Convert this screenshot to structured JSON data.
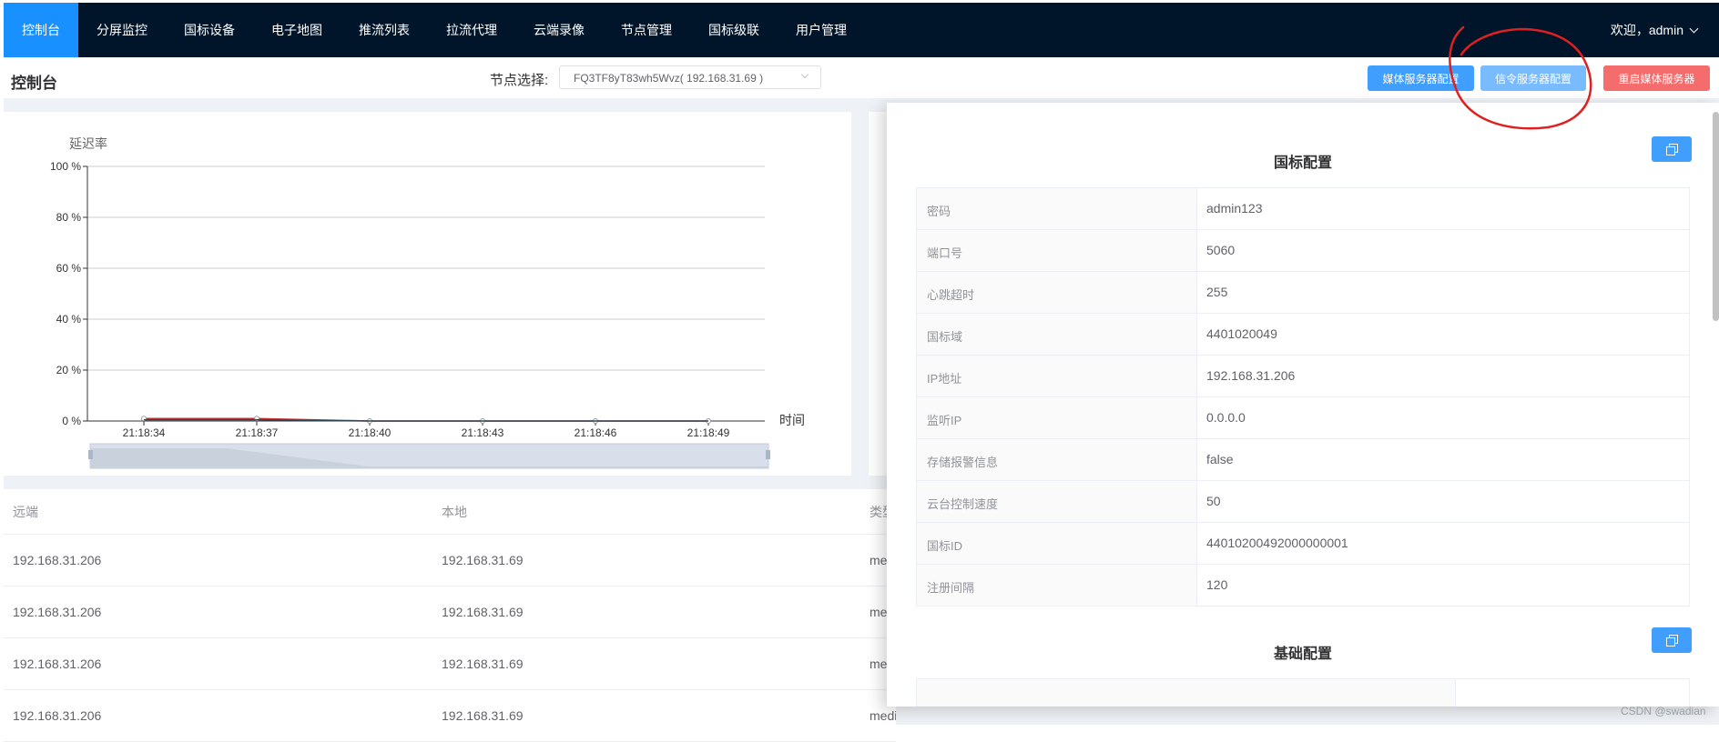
{
  "nav": {
    "items": [
      {
        "label": "控制台",
        "active": true
      },
      {
        "label": "分屏监控"
      },
      {
        "label": "国标设备"
      },
      {
        "label": "电子地图"
      },
      {
        "label": "推流列表"
      },
      {
        "label": "拉流代理"
      },
      {
        "label": "云端录像"
      },
      {
        "label": "节点管理"
      },
      {
        "label": "国标级联"
      },
      {
        "label": "用户管理"
      }
    ],
    "welcome": "欢迎，admin",
    "brand_color": "#001529",
    "active_color": "#1890ff"
  },
  "header": {
    "title": "控制台",
    "node_label": "节点选择:",
    "node_value": "FQ3TF8yT83wh5Wvz( 192.168.31.69 )",
    "btn_media": "媒体服务器配置",
    "btn_signal": "信令服务器配置",
    "btn_restart": "重启媒体服务器"
  },
  "chart_data": {
    "type": "line",
    "title": "",
    "ylabel": "延迟率",
    "xlabel": "时间",
    "ylim": [
      0,
      100
    ],
    "yticks": [
      "100 %",
      "80 %",
      "60 %",
      "40 %",
      "20 %",
      "0 %"
    ],
    "categories": [
      "21:18:34",
      "21:18:37",
      "21:18:40",
      "21:18:43",
      "21:18:46",
      "21:18:49"
    ],
    "series": [
      {
        "name": "",
        "color": "#c23531",
        "values": [
          1,
          1,
          0,
          0,
          0,
          0
        ]
      },
      {
        "name": "",
        "color": "#2f4554",
        "values": [
          0.5,
          0.5,
          0,
          0,
          0,
          0
        ]
      }
    ],
    "grid": true,
    "datazoom": true
  },
  "table": {
    "headers": [
      "远端",
      "本地",
      "类型"
    ],
    "rows": [
      [
        "192.168.31.206",
        "192.168.31.69",
        "mediakit::HttpSession"
      ],
      [
        "192.168.31.206",
        "192.168.31.69",
        "mediakit::HttpSession"
      ],
      [
        "192.168.31.206",
        "192.168.31.69",
        "mediakit::HttpSession"
      ],
      [
        "192.168.31.206",
        "192.168.31.69",
        "mediakit::HttpSession"
      ]
    ]
  },
  "drawer": {
    "section1_title": "国标配置",
    "rows": [
      {
        "label": "密码",
        "value": "admin123"
      },
      {
        "label": "端口号",
        "value": "5060"
      },
      {
        "label": "心跳超时",
        "value": "255"
      },
      {
        "label": "国标域",
        "value": "4401020049"
      },
      {
        "label": "IP地址",
        "value": "192.168.31.206"
      },
      {
        "label": "监听IP",
        "value": "0.0.0.0"
      },
      {
        "label": "存储报警信息",
        "value": "false"
      },
      {
        "label": "云台控制速度",
        "value": "50"
      },
      {
        "label": "国标ID",
        "value": "44010200492000000001"
      },
      {
        "label": "注册间隔",
        "value": "120"
      }
    ],
    "section2_title": "基础配置"
  },
  "watermark": "CSDN @swadian",
  "annotation_color": "#e02020"
}
